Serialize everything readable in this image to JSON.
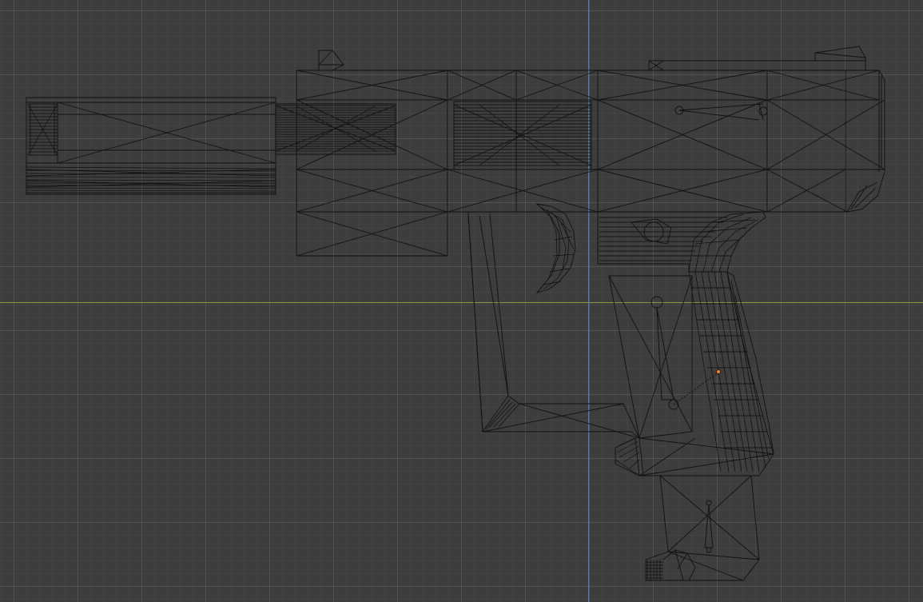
{
  "view": {
    "mode": "wireframe",
    "background_color": "#3d3d3d",
    "grid_color": "#4a4a4a",
    "wire_color": "#111111"
  },
  "axes": {
    "x_axis_color": "#7fa03d",
    "y_axis_color": "#4a7ec9"
  },
  "selection": {
    "origin_color": "#f08a24"
  },
  "object": {
    "type": "mesh",
    "shape": "pistol"
  }
}
